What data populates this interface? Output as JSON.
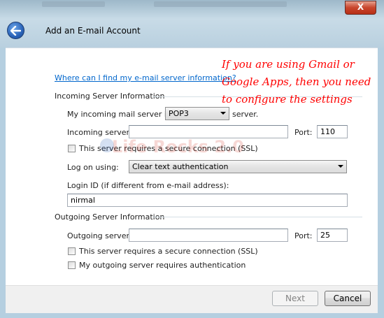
{
  "window": {
    "title": "Add an E-mail Account",
    "close_glyph": "X"
  },
  "help_link": "Where can I find my e-mail server information?",
  "incoming": {
    "group_label": "Incoming Server Information",
    "server_type_prefix": "My incoming mail server is a",
    "server_type_value": "POP3",
    "server_type_suffix": "server.",
    "server_label": "Incoming server:",
    "server_value": "",
    "port_label": "Port:",
    "port_value": "110",
    "ssl_label": "This server requires a secure connection (SSL)",
    "ssl_checked": false,
    "logon_label": "Log on using:",
    "logon_value": "Clear text authentication",
    "login_id_label": "Login ID (if different from e-mail address):",
    "login_id_value": "nirmal"
  },
  "outgoing": {
    "group_label": "Outgoing Server Information",
    "server_label": "Outgoing server:",
    "server_value": "",
    "port_label": "Port:",
    "port_value": "25",
    "ssl_label": "This server requires a secure connection (SSL)",
    "ssl_checked": false,
    "auth_label": "My outgoing server requires authentication",
    "auth_checked": false
  },
  "buttons": {
    "next_label": "Next",
    "cancel_label": "Cancel"
  },
  "annotation": {
    "text": "If you are using Gmail or Google Apps, then you need to configure the settings",
    "color": "#ff0000"
  },
  "watermark": {
    "text": "Life Rocks 2.0"
  },
  "colors": {
    "link": "#0066cc",
    "frame": "#b5cfe0",
    "close_button": "#c8452c"
  }
}
